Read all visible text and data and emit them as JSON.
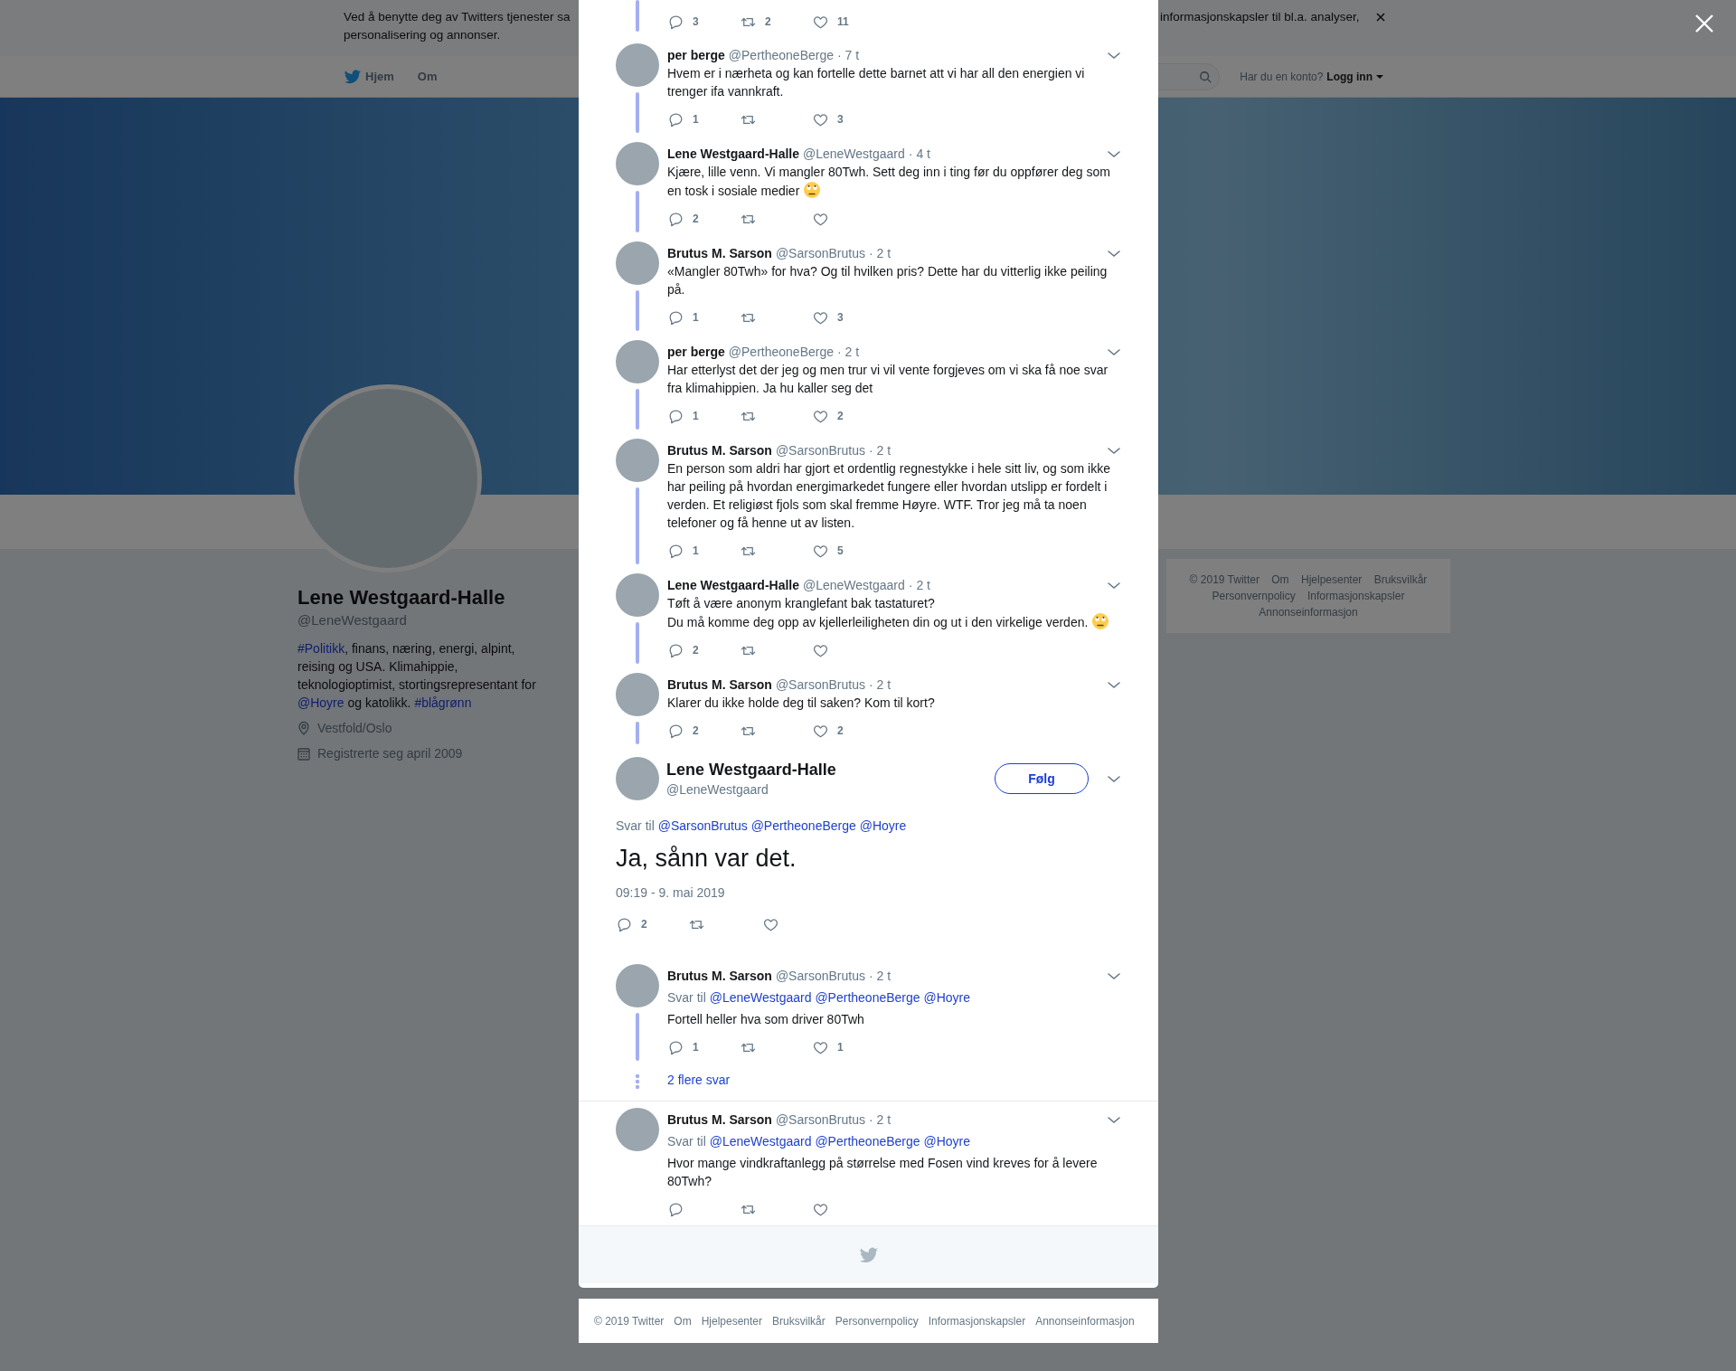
{
  "cookie_banner": {
    "lines_left": [
      "Ved å benytte deg av Twitters tjenester sa",
      "personalisering og annonser."
    ],
    "text_right": "informasjonskapsler til bl.a. analyser,"
  },
  "navbar": {
    "items": [
      {
        "label": "Hjem",
        "kind": "home"
      },
      {
        "label": "Om",
        "kind": "plain"
      }
    ],
    "account_prompt": "Har du en konto?",
    "login_label": "Logg inn"
  },
  "profile": {
    "name": "Lene Westgaard-Halle",
    "handle": "@LeneWestgaard",
    "bio": [
      {
        "kind": "link",
        "text": "#Politikk"
      },
      {
        "kind": "text",
        "text": ", finans, næring, energi, alpint, reising og USA. Klimahippie, teknologioptimist, stortingsrepresentant for "
      },
      {
        "kind": "link",
        "text": "@Hoyre"
      },
      {
        "kind": "text",
        "text": " og katolikk. "
      },
      {
        "kind": "link",
        "text": "#blågrønn"
      }
    ],
    "location": "Vestfold/Oslo",
    "joined": "Registrerte seg april 2009"
  },
  "side_footer": {
    "links": [
      "© 2019 Twitter",
      "Om",
      "Hjelpesenter",
      "Bruksvilkår",
      "Personvernpolicy",
      "Informasjonskapsler",
      "Annonseinformasjon"
    ]
  },
  "thread": {
    "tweets": [
      {
        "kind": "partial",
        "thread_line": true,
        "counts": {
          "replies": "3",
          "retweets": "2",
          "likes": "11"
        }
      },
      {
        "kind": "normal",
        "author": "per berge",
        "handle": "@PertheoneBerge",
        "time": "· 7 t",
        "text": "Hvem er i nærheta og kan fortelle dette barnet att vi har all den energien vi trenger ifa vannkraft.",
        "thread_line": true,
        "counts": {
          "replies": "1",
          "likes": "3"
        }
      },
      {
        "kind": "normal",
        "author": "Lene Westgaard-Halle",
        "handle": "@LeneWestgaard",
        "time": "· 4 t",
        "text": "Kjære, lille venn. Vi mangler 80Twh. Sett deg inn i ting før du oppfører deg som en tosk i sosiale medier",
        "emoji": true,
        "thread_line": true,
        "counts": {
          "replies": "2"
        }
      },
      {
        "kind": "normal",
        "author": "Brutus M. Sarson",
        "handle": "@SarsonBrutus",
        "time": "· 2 t",
        "text": "«Mangler 80Twh» for hva? Og til hvilken pris? Dette har du vitterlig ikke peiling på.",
        "thread_line": true,
        "counts": {
          "replies": "1",
          "likes": "3"
        }
      },
      {
        "kind": "normal",
        "author": "per berge",
        "handle": "@PertheoneBerge",
        "time": "· 2 t",
        "text": "Har etterlyst det der jeg og men trur vi vil vente forgjeves om vi ska få noe svar fra klimahippien. Ja hu kaller seg det",
        "thread_line": true,
        "counts": {
          "replies": "1",
          "likes": "2"
        }
      },
      {
        "kind": "normal",
        "author": "Brutus M. Sarson",
        "handle": "@SarsonBrutus",
        "time": "· 2 t",
        "text": "En person som aldri har gjort et ordentlig regnestykke i hele sitt liv, og som ikke har peiling på hvordan energimarkedet fungere eller hvordan utslipp er fordelt i verden. Et religiøst fjols som skal fremme Høyre. WTF. Tror jeg må ta noen telefoner og få henne ut av listen.",
        "thread_line": true,
        "counts": {
          "replies": "1",
          "likes": "5"
        }
      },
      {
        "kind": "normal",
        "author": "Lene Westgaard-Halle",
        "handle": "@LeneWestgaard",
        "time": "· 2 t",
        "text": "Tøft å være anonym kranglefant bak tastaturet?\nDu må komme deg opp av kjellerleiligheten din og ut i den virkelige verden.",
        "emoji": true,
        "thread_line": true,
        "counts": {
          "replies": "2"
        }
      },
      {
        "kind": "normal",
        "author": "Brutus M. Sarson",
        "handle": "@SarsonBrutus",
        "time": "· 2 t",
        "text": "Klarer du ikke holde deg til saken? Kom til kort?",
        "thread_line": true,
        "counts": {
          "replies": "2",
          "likes": "2"
        }
      },
      {
        "kind": "focused",
        "author": "Lene Westgaard-Halle",
        "handle": "@LeneWestgaard",
        "follow_label": "Følg",
        "reply_to": {
          "label": "Svar til",
          "mentions": [
            "@SarsonBrutus",
            "@PertheoneBerge",
            "@Hoyre"
          ]
        },
        "text": "Ja, sånn var det.",
        "time": "09:19 - 9. mai 2019",
        "counts": {
          "replies": "2"
        }
      },
      {
        "kind": "normal",
        "author": "Brutus M. Sarson",
        "handle": "@SarsonBrutus",
        "time": "· 2 t",
        "reply_to": {
          "label": "Svar til",
          "mentions": [
            "@LeneWestgaard",
            "@PertheoneBerge",
            "@Hoyre"
          ]
        },
        "text": "Fortell heller hva som driver 80Twh",
        "thread_line": true,
        "counts": {
          "replies": "1",
          "likes": "1"
        },
        "more_replies": "2 flere svar"
      },
      {
        "kind": "normal",
        "author": "Brutus M. Sarson",
        "handle": "@SarsonBrutus",
        "time": "· 2 t",
        "reply_to": {
          "label": "Svar til",
          "mentions": [
            "@LeneWestgaard",
            "@PertheoneBerge",
            "@Hoyre"
          ]
        },
        "text": "Hvor mange vindkraftanlegg på størrelse med Fosen vind kreves for å levere 80Twh?"
      }
    ]
  },
  "modal_footer": {
    "links": [
      "© 2019 Twitter",
      "Om",
      "Hjelpesenter",
      "Bruksvilkår",
      "Personvernpolicy",
      "Informasjonskapsler",
      "Annonseinformasjon"
    ]
  }
}
